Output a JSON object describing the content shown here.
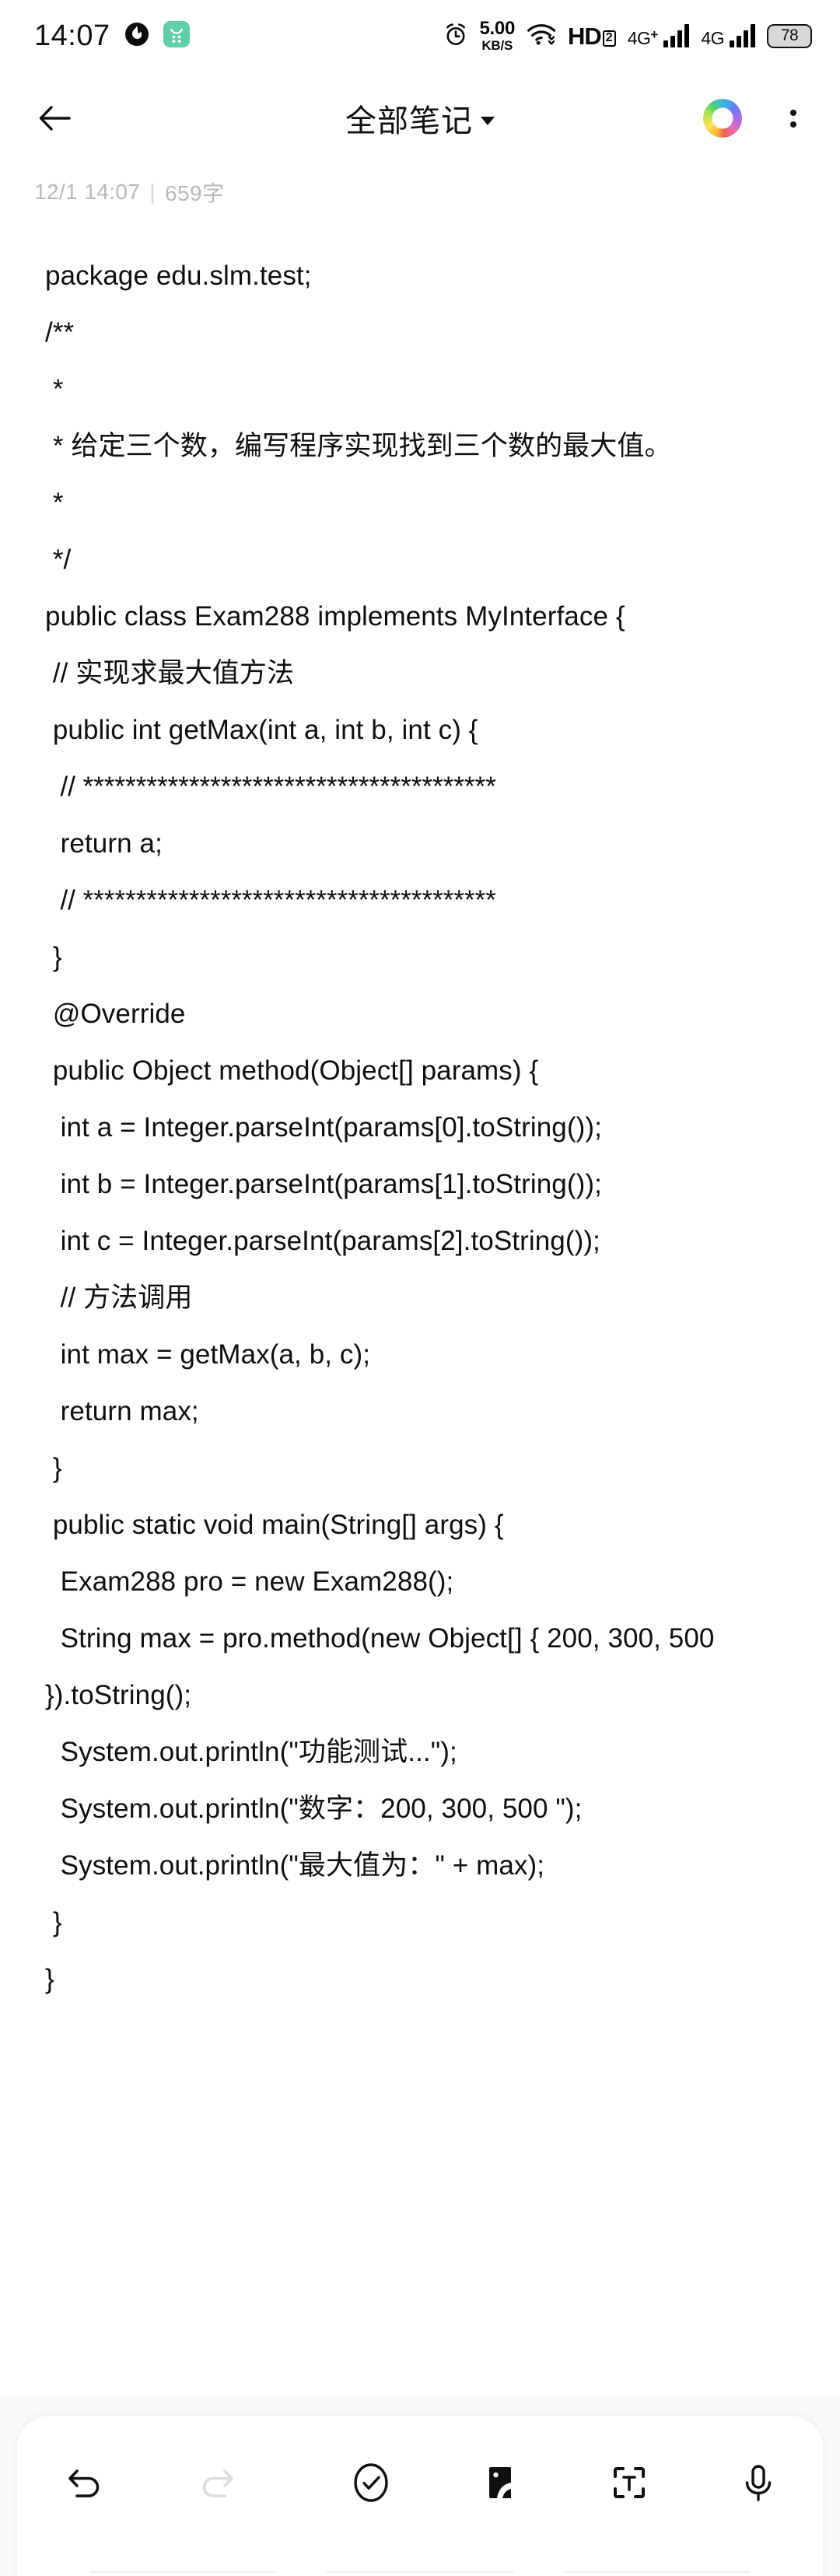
{
  "status_bar": {
    "time": "14:07",
    "app_icon_1": "fire-droplet-icon",
    "app_icon_2": "green-app-icon",
    "alarm_icon": "alarm-clock-icon",
    "net_speed_value": "5.00",
    "net_speed_unit": "KB/S",
    "wifi_icon": "wifi-icon",
    "hd_label": "HD",
    "hd_sub": "2",
    "sim1_label": "4G",
    "sim1_plus": "+",
    "sim2_label": "4G",
    "battery_level": "78"
  },
  "header": {
    "back_icon": "back-arrow-icon",
    "title": "全部笔记",
    "dropdown_icon": "chevron-down-icon",
    "theme_icon": "rainbow-ring-icon",
    "more_icon": "more-vertical-icon"
  },
  "meta": {
    "date_time": "12/1 14:07",
    "separator": "|",
    "word_count": "659字"
  },
  "note": {
    "lines": [
      "package edu.slm.test;",
      "/**",
      " *",
      " * 给定三个数，编写程序实现找到三个数的最大值。",
      " *",
      " */",
      "public class Exam288 implements MyInterface {",
      " // 实现求最大值方法",
      " public int getMax(int a, int b, int c) {",
      "  // ***************************************",
      "  return a;",
      "  // ***************************************",
      " }",
      " @Override",
      " public Object method(Object[] params) {",
      "  int a = Integer.parseInt(params[0].toString());",
      "  int b = Integer.parseInt(params[1].toString());",
      "  int c = Integer.parseInt(params[2].toString());",
      "  // 方法调用",
      "  int max = getMax(a, b, c);",
      "  return max;",
      " }",
      " public static void main(String[] args) {",
      "  Exam288 pro = new Exam288();",
      "  String max = pro.method(new Object[] { 200, 300, 500 }).toString();",
      "  System.out.println(\"功能测试...\");",
      "  System.out.println(\"数字：200, 300, 500 \");",
      "  System.out.println(\"最大值为：\" + max);",
      " }",
      "}"
    ]
  },
  "toolbar": {
    "undo_icon": "undo-icon",
    "redo_icon": "redo-icon",
    "checklist_icon": "check-circle-icon",
    "image_icon": "image-icon",
    "scan_text_icon": "scan-text-icon",
    "voice_icon": "microphone-icon",
    "undo_enabled": "true",
    "redo_enabled": "false"
  },
  "colors": {
    "accent_green": "#5ecfa6",
    "text_primary": "#0f0f0f",
    "text_muted": "#b9b9b9",
    "battery_fill": "#d8d8d8"
  }
}
